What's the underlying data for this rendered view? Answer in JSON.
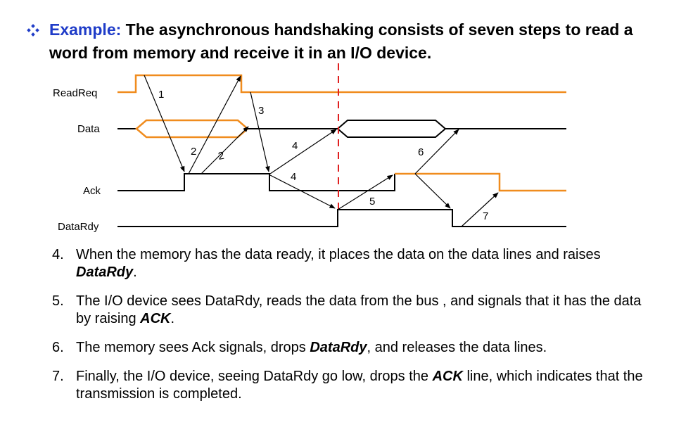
{
  "heading": {
    "label": "Example:",
    "text": " The asynchronous handshaking consists of seven steps to read a word from memory and receive it in an I/O device."
  },
  "signals": {
    "readreq": "ReadReq",
    "data": "Data",
    "ack": "Ack",
    "datardy": "DataRdy"
  },
  "arrow_labels": {
    "a1": "1",
    "a2a": "2",
    "a2b": "2",
    "a3": "3",
    "a4a": "4",
    "a4b": "4",
    "a5": "5",
    "a6": "6",
    "a7": "7"
  },
  "steps": [
    {
      "num": "4.",
      "pre": "When the memory has the data ready, it places the data on the data lines and raises ",
      "bold": "DataRdy",
      "post": "."
    },
    {
      "num": "5.",
      "pre": "The I/O device sees DataRdy, reads the data from the bus , and signals that it has the data by raising ",
      "bold": "ACK",
      "post": "."
    },
    {
      "num": "6.",
      "pre": "The memory sees Ack signals, drops ",
      "bold": "DataRdy",
      "post": ", and releases the data lines."
    },
    {
      "num": "7.",
      "pre": "Finally, the I/O device, seeing DataRdy go low, drops the ",
      "bold": "ACK",
      "post": " line, which indicates that the transmission is completed."
    }
  ],
  "colors": {
    "orange": "#f08c1e",
    "black": "#000000",
    "heading_label": "#1f3cc8",
    "dashed_red": "#e02020",
    "bullet": "#1f3cc8"
  }
}
